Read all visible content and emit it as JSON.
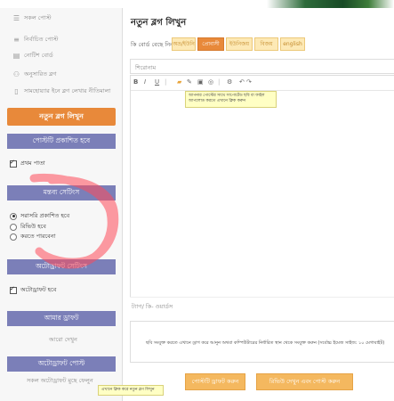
{
  "sidebar": {
    "menu": [
      {
        "icon": "stack-icon",
        "label": "সকল পোস্ট"
      },
      {
        "icon": "list-icon",
        "label": "নির্বাচিত পোস্ট"
      },
      {
        "icon": "notes-icon",
        "label": "নোটিশ বোর্ড"
      },
      {
        "icon": "people-icon",
        "label": "অনুসারিত ব্লগ"
      },
      {
        "icon": "page-icon",
        "label": "সামহোয়্যার ইনে ব্লগ লেখার নীতিমালা"
      }
    ],
    "new_blog_button": "নতুন ব্লগ লিখুন",
    "publish_section": {
      "title": "পোস্টটি প্রকাশিত হবে",
      "option": "প্রথম পাতা",
      "checked": true
    },
    "comment_section": {
      "title": "মন্তব্য সেটিংস",
      "options": [
        "সরাসরি প্রকাশিত হবে",
        "রিভিউ হবে",
        "করতে পারবেনা"
      ],
      "selected": 0
    },
    "autodraft_section": {
      "title": "অটোড্রাফট সেটিংস",
      "option": "অটোড্রাফট হবে",
      "checked": true
    },
    "my_draft": {
      "title": "আমার ড্রাফট",
      "link": "আরো দেখুন"
    },
    "autodraft_post": {
      "title": "অটোড্রাফট পোস্ট",
      "link": "সকল অটোড্রাফট মুছে ফেলুন"
    }
  },
  "main": {
    "title": "নতুন ব্লগ লিখুন",
    "keyboard_label": "কি বোর্ড বেছে নিন:",
    "keyboard_options": [
      "অভ্র/ইউনি",
      "প্রোবাসী",
      "ইউনিজয়",
      "বিজয়",
      "english"
    ],
    "keyboard_selected": 1,
    "title_placeholder": "শিরোনাম",
    "toolbar_labels": {
      "bold": "B",
      "italic": "I",
      "underline": "U"
    },
    "editor_tooltip": "আপনার পোস্টের সাথে সাপোর্টেড ছবি বা ফাইল আপলোড করতে এখানে ক্লিক করুন",
    "tags_placeholder": "ট্যাগ/ কি- ওয়ার্ডস",
    "info_text": "ছবি সংযুক্ত করতে এখানে ড্রাগ করে আনুন অথবা কম্পিউটারের নির্ধারিত স্থান থেকে সংযুক্ত করুন (সর্বোচ্চ ইমেজ সাইজ: ১০ মেগাবাইট)",
    "draft_button": "পোস্টটি ড্রাফট করুন",
    "review_button": "রিভিউ দেখুন এবং পোস্ট করুন"
  },
  "footer_tooltip": "এখানে ক্লিক করে নতুন ব্লগ লিখুন",
  "colors": {
    "accent": "#e8893a",
    "section": "#7b7fb8",
    "scribble": "#ff4a5a"
  }
}
